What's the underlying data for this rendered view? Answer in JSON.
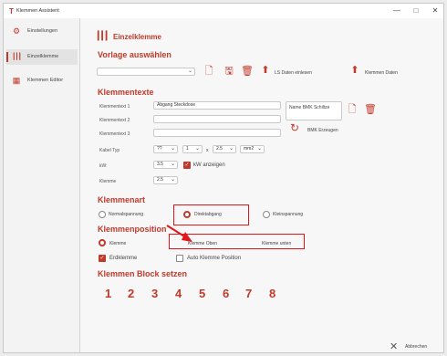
{
  "window": {
    "title": "Klemmen Assistent",
    "app_icon": "T",
    "min": "—",
    "max": "□",
    "close": "✕"
  },
  "sidebar": {
    "items": [
      {
        "label": "Einstellungen",
        "icon": "gear-icon",
        "glyph": "⚙"
      },
      {
        "label": "Einzelklemme",
        "icon": "terminal-icon",
        "glyph": "┃┃┃"
      },
      {
        "label": "Klemmen Editor",
        "icon": "building-icon",
        "glyph": "▦"
      }
    ]
  },
  "header": {
    "title": "Einzelklemme",
    "icon_glyph": "┃┃┃"
  },
  "vorlage": {
    "section": "Vorlage auswählen",
    "select_value": "",
    "ls_button": "LS Daten einlesen",
    "klemmen_daten_button": "Klemmen Daten"
  },
  "klemmentexte": {
    "section": "Klemmentexte",
    "text1_label": "Klemmentext 1",
    "text1_value": "Abgang Steckdose",
    "text2_label": "Klemmentext 2",
    "text2_value": "",
    "text3_label": "Klemmentext 3",
    "text3_value": "",
    "bmk_box": "Name BMK Schiltze",
    "bmk_erzeugen": "BMK Erzeugen",
    "kabel_label": "Kabel Typ",
    "kabel_typ": "??",
    "kabel_adern": "1",
    "kabel_x": "x",
    "kabel_quer": "2.5",
    "kabel_einheit": "mm2",
    "kw_label": "kW:",
    "kw_value": "3.5",
    "kw_anzeigen": "kW anzeigen",
    "klemme_label": "Klemme",
    "klemme_value": "2.5"
  },
  "klemmenart": {
    "section": "Klemmenart",
    "options": [
      "Normalspannung",
      "Direktabgang",
      "Kleinspannung"
    ],
    "selected": "Direktabgang"
  },
  "klemmenposition": {
    "section": "Klemmenposition",
    "klemme": "Klemme",
    "klemme_oben": "Klemme Oben",
    "klemme_unten": "Klemme unten",
    "erdklemme": "Erdklemme",
    "auto_position": "Auto Klemme Position"
  },
  "block": {
    "section": "Klemmen Block setzen",
    "numbers": [
      "1",
      "2",
      "3",
      "4",
      "5",
      "6",
      "7",
      "8"
    ]
  },
  "footer": {
    "abbrechen": "Abbrechen",
    "close_glyph": "✕"
  },
  "colors": {
    "accent": "#c0392b",
    "highlight": "#e0161b"
  }
}
